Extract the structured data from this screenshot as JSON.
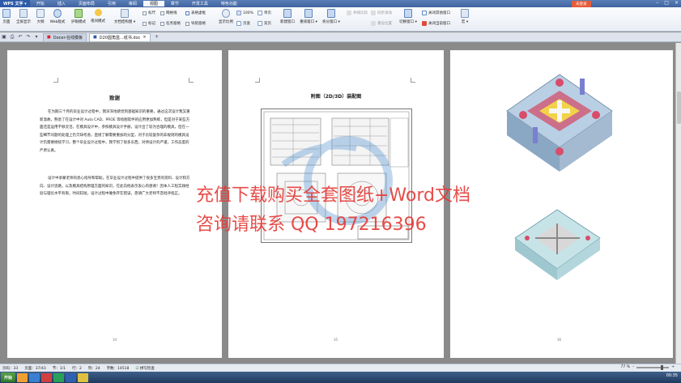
{
  "title": {
    "app": "WPS 文字",
    "login": "未登录"
  },
  "menu": [
    "开始",
    "插入",
    "页面布局",
    "引用",
    "审阅",
    "视图",
    "章节",
    "开发工具",
    "特色功能"
  ],
  "menu_active_index": 5,
  "ribbon": {
    "views": [
      "页面",
      "全屏显示",
      "大纲",
      "Web版式",
      "护眼模式",
      "夜间模式"
    ],
    "nav": "文档结构图",
    "checks": [
      {
        "label": "标尺",
        "checked": false
      },
      {
        "label": "网格线",
        "checked": false
      },
      {
        "label": "表格虚框",
        "checked": true
      },
      {
        "label": "标记",
        "checked": false
      },
      {
        "label": "任务窗格",
        "checked": false
      },
      {
        "label": "导航窗格",
        "checked": false
      }
    ],
    "zoom": {
      "label": "显示比例",
      "pct": "100%",
      "single": "单页",
      "pagewidth": "页宽",
      "double": "双页"
    },
    "window": [
      "新建窗口",
      "重排窗口",
      "拆分窗口",
      "并排比较",
      "同步滚动",
      "重设位置",
      "切换窗口"
    ],
    "close": [
      "关闭其他窗口",
      "关闭当前窗口"
    ],
    "macro": "宏"
  },
  "tabs": [
    {
      "label": "Docer-在线模板",
      "active": false
    },
    {
      "label": "D20圆角盒...纸书.doc",
      "active": true
    }
  ],
  "page1": {
    "title": "致谢",
    "paragraphs": [
      "在为期三个月的毕业设计过程中，我深深地感觉到基础知识的重要，通过这次设计我又重新温故，熟悉了在设计中对 Auto CAD、PROE 等绘图软件的应用更加熟练，但是对于某些方面还是运用不够灵活。在模具设计中，参照模具设计手册，设计出了较为合理的模具，但在一些细节问题的处理上仍欠缺考虑，直接了解需要重加的分型，对于比较复杂的非规则的模具设计仍需要继续学习，整个毕业设计过程中，我学到了很多东西，对待设计的严谨，工作态度的严肃认真。",
      "设计中承蒙老师的悉心指导和帮助，在毕业设计过程中提供了很多宝贵的资料、设计和方向、设计思路，以及模具结构原理方面的知识，在此向他表示衷心的感谢！因本人工程实践经验与理论水平有限，时间较短，设计过程中难免存在错误，恳请广大老师不吝批评指正。"
    ],
    "number": "34"
  },
  "page2": {
    "title": "附图（2D/3D）装配图",
    "number": "35"
  },
  "page3": {
    "number": "36"
  },
  "watermark": {
    "line1": "充值下载购买全套图纸+Word文档",
    "line2": "咨询请联系  QQ 197216396"
  },
  "status": {
    "page": "页码：33",
    "pages": "页面：37/43",
    "section": "节：1/1",
    "row": "行：2",
    "col": "列：24",
    "words": "字数：14518",
    "spell": "拼写检查"
  },
  "zoom_pct": "77 %",
  "clock": "00:35"
}
